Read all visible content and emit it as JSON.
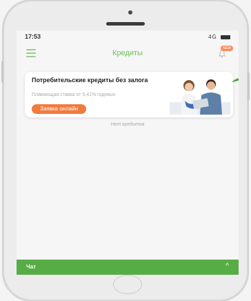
{
  "status": {
    "time": "17:53",
    "signal": "4G"
  },
  "header": {
    "title": "Кредиты",
    "badge": "NEW"
  },
  "banner": {
    "title": "Потребительские кредиты без залога",
    "subtitle": "Плавающая ставка от 5,41% годовых",
    "button_label": "Заявка онлайн"
  },
  "content": {
    "empty_text": "Нет кредитов"
  },
  "chat": {
    "label": "Чат",
    "chevron": "^"
  },
  "colors": {
    "accent_green": "#57ad45",
    "title_green": "#6cbf5a",
    "button_orange": "#f17b3c"
  },
  "icons": [
    "menu-icon",
    "bell-icon",
    "chevron-up-icon",
    "leaf-icon"
  ]
}
